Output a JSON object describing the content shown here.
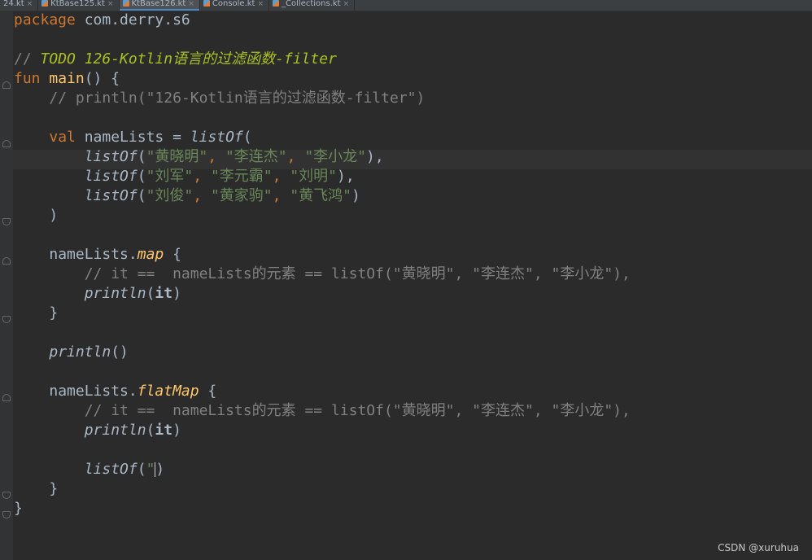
{
  "tabs": [
    {
      "label": "24.kt",
      "active": false
    },
    {
      "label": "KtBase125.kt",
      "active": false
    },
    {
      "label": "KtBase126.kt",
      "active": true
    },
    {
      "label": "Console.kt",
      "active": false
    },
    {
      "label": "_Collections.kt",
      "active": false
    }
  ],
  "tab_close_glyph": "×",
  "code": {
    "l1": {
      "kw": "package",
      "rest": " com.derry.s6"
    },
    "l3": {
      "slash": "// ",
      "todo": "TODO 126-Kotlin语言的过滤函数-filter"
    },
    "l4": {
      "kw": "fun",
      "sp": " ",
      "fn": "main",
      "rest": "() {"
    },
    "l5": {
      "ind": "    ",
      "cmt": "// println(\"126-Kotlin语言的过滤函数-filter\")"
    },
    "l7": {
      "ind": "    ",
      "kw": "val",
      "mid": " nameLists = ",
      "call": "listOf",
      "end": "("
    },
    "l8": {
      "ind": "        ",
      "call": "listOf",
      "p": "(",
      "s1": "\"黄晓明\"",
      "c1": ", ",
      "s2": "\"李连杰\"",
      "c2": ", ",
      "s3": "\"李小龙\"",
      "end": "),"
    },
    "l9": {
      "ind": "        ",
      "call": "listOf",
      "p": "(",
      "s1": "\"刘军\"",
      "c1": ", ",
      "s2": "\"李元霸\"",
      "c2": ", ",
      "s3": "\"刘明\"",
      "end": "),"
    },
    "l10": {
      "ind": "        ",
      "call": "listOf",
      "p": "(",
      "s1": "\"刘俊\"",
      "c1": ", ",
      "s2": "\"黄家驹\"",
      "c2": ", ",
      "s3": "\"黄飞鸿\"",
      "end": ")"
    },
    "l11": {
      "ind": "    ",
      "text": ")"
    },
    "l13": {
      "ind": "    ",
      "recv": "nameLists.",
      "ext": "map",
      "end": " {"
    },
    "l14": {
      "ind": "        ",
      "cmt": "// it ==  nameLists的元素 == listOf(\"黄晓明\", \"李连杰\", \"李小龙\"),"
    },
    "l15": {
      "ind": "        ",
      "call": "println",
      "p": "(",
      "it": "it",
      "end": ")"
    },
    "l16": {
      "ind": "    ",
      "text": "}"
    },
    "l18": {
      "ind": "    ",
      "call": "println",
      "end": "()"
    },
    "l20": {
      "ind": "    ",
      "recv": "nameLists.",
      "ext": "flatMap",
      "end": " {"
    },
    "l21": {
      "ind": "        ",
      "cmt": "// it ==  nameLists的元素 == listOf(\"黄晓明\", \"李连杰\", \"李小龙\"),"
    },
    "l22": {
      "ind": "        ",
      "call": "println",
      "p": "(",
      "it": "it",
      "end": ")"
    },
    "l24": {
      "ind": "        ",
      "call": "listOf",
      "p": "(",
      "str": "\"",
      "end": ")"
    },
    "l25": {
      "ind": "    ",
      "text": "}"
    },
    "l26": {
      "text": "}"
    }
  },
  "watermark": "CSDN @xuruhua",
  "colors": {
    "background": "#2b2b2b",
    "keyword": "#cc7832",
    "string": "#6a8759",
    "comment": "#808080",
    "todo": "#a8c023",
    "function": "#ffc66d",
    "text": "#a9b7c6"
  }
}
